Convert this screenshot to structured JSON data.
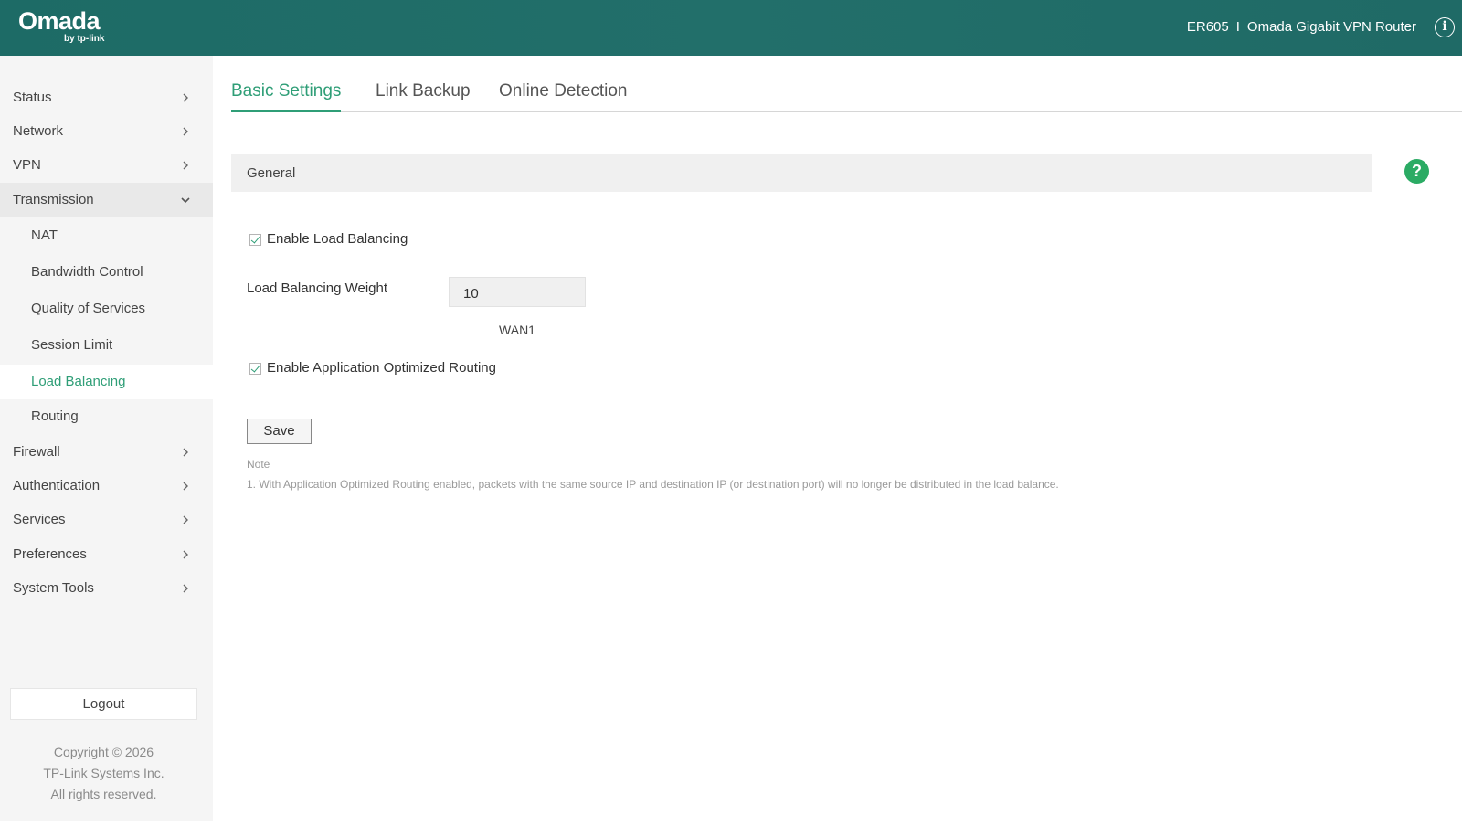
{
  "header": {
    "logo_main": "Omada",
    "logo_sub": "by tp-link",
    "model": "ER605",
    "separator": "I",
    "product_name": "Omada Gigabit VPN Router",
    "info_icon": "i",
    "colors": {
      "bar": "#1d6b66",
      "accent": "#2f9e77"
    }
  },
  "sidebar": {
    "items": [
      {
        "label": "Status"
      },
      {
        "label": "Network"
      },
      {
        "label": "VPN"
      },
      {
        "label": "Transmission",
        "expanded": true
      },
      {
        "label": "NAT"
      },
      {
        "label": "Bandwidth Control"
      },
      {
        "label": "Quality of Services"
      },
      {
        "label": "Session Limit"
      },
      {
        "label": "Load Balancing",
        "active": true
      },
      {
        "label": "Routing"
      },
      {
        "label": "Firewall"
      },
      {
        "label": "Authentication"
      },
      {
        "label": "Services"
      },
      {
        "label": "Preferences"
      },
      {
        "label": "System Tools"
      }
    ],
    "logout_label": "Logout",
    "copyright": {
      "line1": "Copyright © 2026",
      "line2": "TP-Link Systems Inc.",
      "line3": "All rights reserved."
    }
  },
  "tabs": [
    {
      "label": "Basic Settings",
      "active": true
    },
    {
      "label": "Link Backup"
    },
    {
      "label": "Online Detection"
    }
  ],
  "section": {
    "title": "General",
    "help_icon": "?"
  },
  "form": {
    "enable_load_balancing": {
      "label": "Enable Load Balancing",
      "checked": true
    },
    "weight_label": "Load Balancing Weight",
    "weight_value": "10",
    "wan_label": "WAN1",
    "enable_app_routing": {
      "label": "Enable Application Optimized Routing",
      "checked": true
    },
    "save_label": "Save"
  },
  "note": {
    "title": "Note",
    "text": "1. With Application Optimized Routing enabled, packets with the same source IP and destination IP (or destination port) will no longer be distributed in the load balance."
  }
}
